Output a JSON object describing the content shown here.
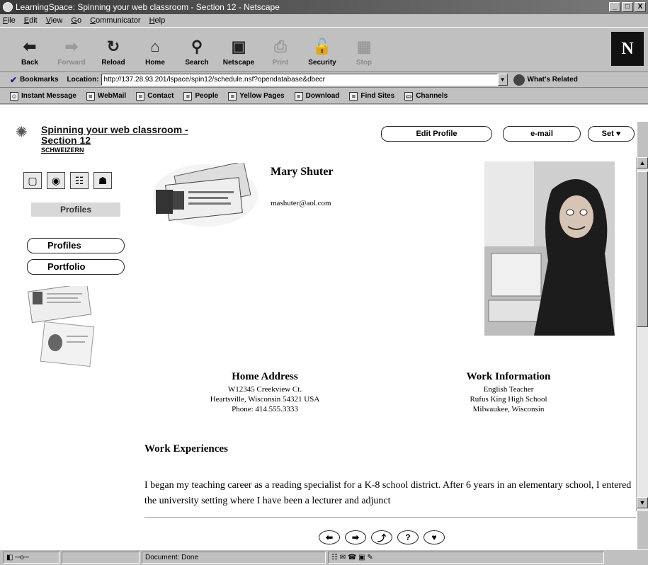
{
  "window": {
    "title": "LearningSpace: Spinning your web classroom - Section 12 - Netscape",
    "controls": [
      "_",
      "□",
      "X"
    ]
  },
  "menu": [
    "File",
    "Edit",
    "View",
    "Go",
    "Communicator",
    "Help"
  ],
  "nav_buttons": [
    {
      "label": "Back",
      "icon": "back-arrow-icon",
      "enabled": true
    },
    {
      "label": "Forward",
      "icon": "forward-arrow-icon",
      "enabled": false
    },
    {
      "label": "Reload",
      "icon": "reload-icon",
      "enabled": true
    },
    {
      "label": "Home",
      "icon": "home-icon",
      "enabled": true
    },
    {
      "label": "Search",
      "icon": "search-icon",
      "enabled": true
    },
    {
      "label": "Netscape",
      "icon": "netscape-icon",
      "enabled": true
    },
    {
      "label": "Print",
      "icon": "print-icon",
      "enabled": false
    },
    {
      "label": "Security",
      "icon": "lock-icon",
      "enabled": true
    },
    {
      "label": "Stop",
      "icon": "stop-icon",
      "enabled": false
    }
  ],
  "brand_logo": "N",
  "location": {
    "bookmarks_label": "Bookmarks",
    "location_label": "Location:",
    "url": "http://137.28.93.201/lspace/spin12/schedule.nsf?opendatabase&dbecr",
    "related_label": "What's Related"
  },
  "personal_toolbar": [
    "Instant Message",
    "WebMail",
    "Contact",
    "People",
    "Yellow Pages",
    "Download",
    "Find Sites",
    "Channels"
  ],
  "course": {
    "title_line1": "Spinning your web classroom -",
    "title_line2": "Section 12",
    "subtitle": "SCHWEIZERN"
  },
  "header_buttons": {
    "edit_profile": "Edit Profile",
    "email": "e-mail",
    "set": "Set ♥"
  },
  "sidebar": {
    "section_label": "Profiles",
    "buttons": [
      "Profiles",
      "Portfolio"
    ]
  },
  "profile": {
    "name": "Mary Shuter",
    "email": "mashuter@aol.com",
    "home_address": {
      "heading": "Home Address",
      "lines": [
        "W12345 Creekview Ct.",
        "Heartsville, Wisconsin 54321 USA",
        "Phone: 414.555.3333"
      ]
    },
    "work_information": {
      "heading": "Work Information",
      "lines": [
        "English Teacher",
        "Rufus King High School",
        "Milwaukee, Wisconsin"
      ]
    },
    "work_experiences_heading": "Work Experiences",
    "work_experiences_text": "I began my teaching career as a reading specialist for a K-8 school district. After 6 years in an elementary school, I entered the university setting where I have been a lecturer and adjunct"
  },
  "bottom_nav": [
    "back",
    "forward",
    "up",
    "help",
    "favorite"
  ],
  "status": {
    "text": "Document: Done"
  }
}
